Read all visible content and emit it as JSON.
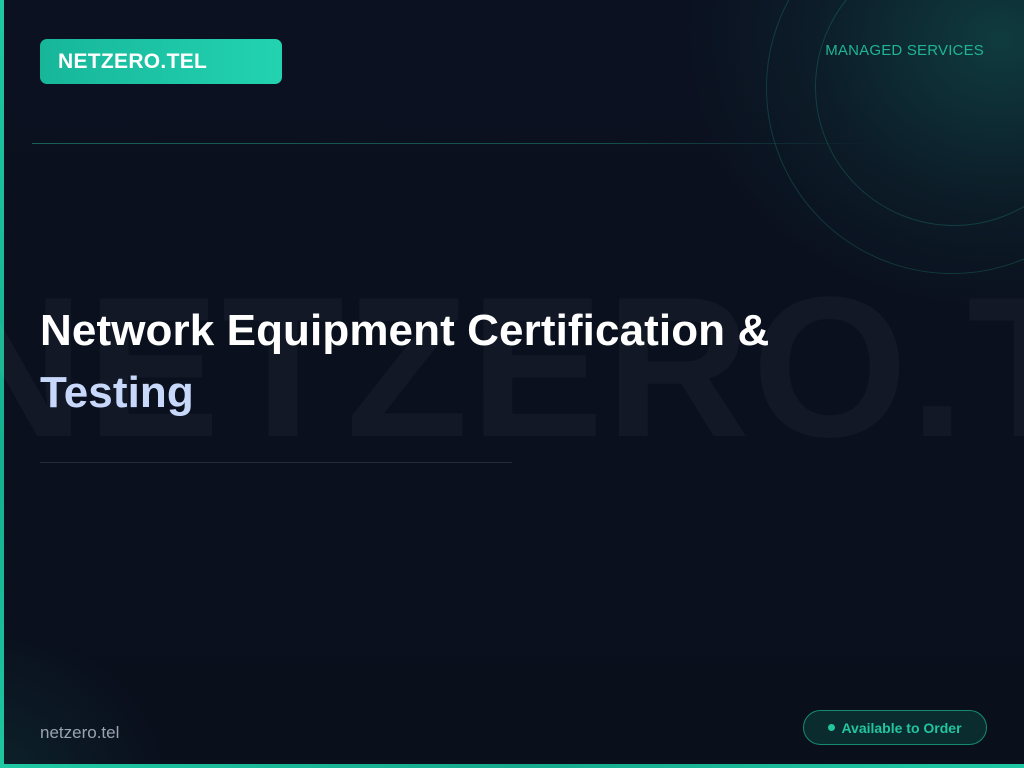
{
  "brand": {
    "badge_text": "NETZERO.TEL",
    "watermark_text": "NETZERO.TEL",
    "footer_domain": "netzero.tel"
  },
  "header": {
    "category": "MANAGED SERVICES"
  },
  "title": {
    "line1": "Network Equipment Certification &",
    "line2": "Testing"
  },
  "status": {
    "label": "Available to Order"
  },
  "colors": {
    "background": "#0b1120",
    "accent_teal": "#1fc9a3",
    "title_text": "#ffffff",
    "title_accent": "#c7d8fb",
    "footer_text": "#9aa3b2"
  }
}
